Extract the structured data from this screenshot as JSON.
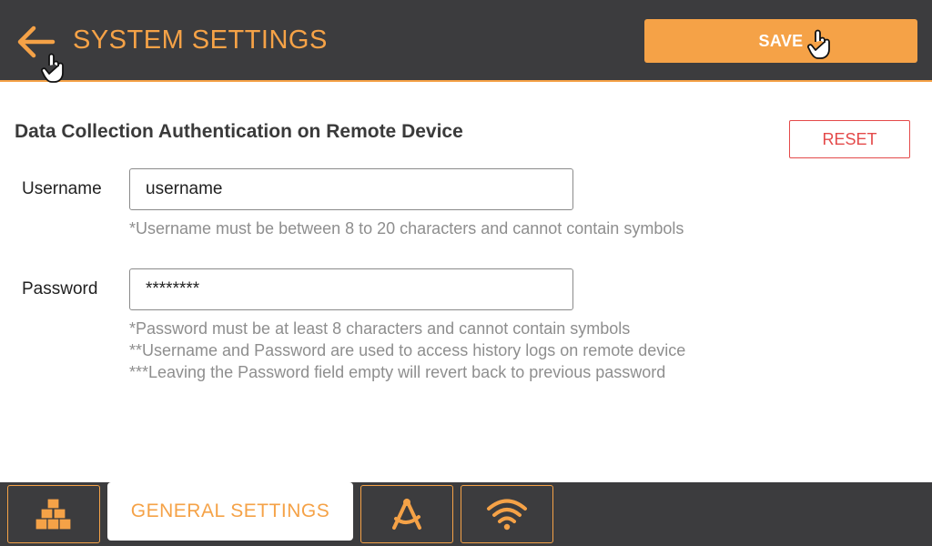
{
  "header": {
    "title": "SYSTEM SETTINGS",
    "save_label": "SAVE"
  },
  "section": {
    "title": "Data Collection Authentication on Remote Device",
    "reset_label": "RESET"
  },
  "username": {
    "label": "Username",
    "value": "username",
    "hint": "*Username must be between 8 to 20 characters and cannot contain symbols"
  },
  "password": {
    "label": "Password",
    "value": "********",
    "hints": [
      "*Password must be at least 8 characters and cannot contain symbols",
      "**Username and Password are used to access history logs on remote device",
      "***Leaving the Password field empty will revert back to previous password"
    ]
  },
  "nav": {
    "tabs": [
      {
        "icon": "boxes-icon"
      },
      {
        "label": "GENERAL SETTINGS"
      },
      {
        "icon": "compass-tools-icon"
      },
      {
        "icon": "wifi-icon"
      }
    ]
  },
  "colors": {
    "accent": "#f5a247",
    "header_bg": "#3c3c3e",
    "danger": "#e44a4a",
    "hint_text": "#8e8e8e"
  }
}
